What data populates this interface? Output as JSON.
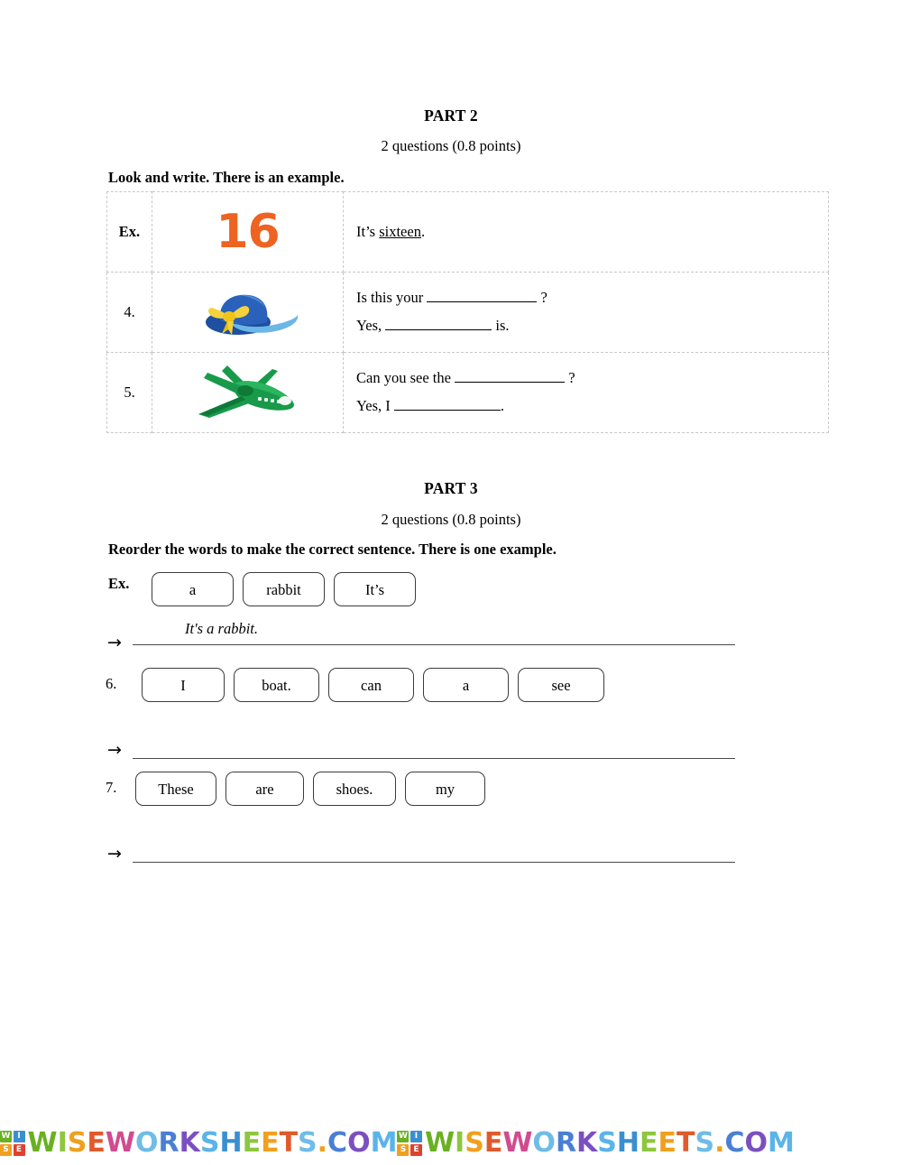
{
  "part2": {
    "title": "PART 2",
    "subtitle": "2 questions (0.8 points)",
    "instruction": "Look and write. There is an example.",
    "rows": [
      {
        "number": "Ex.",
        "picture": "number-16-icon",
        "picture_value": "16",
        "picture_color": "#ee6322",
        "text_pre": "It’s ",
        "answer": "sixteen",
        "text_post": ".",
        "line2": ""
      },
      {
        "number": "4.",
        "picture": "blue-hat-icon",
        "line1_pre": "Is this your ",
        "line1_post": " ?",
        "line2_pre": "Yes, ",
        "line2_post": " is."
      },
      {
        "number": "5.",
        "picture": "green-airplane-icon",
        "line1_pre": "Can you see the ",
        "line1_post": " ?",
        "line2_pre": "Yes, I ",
        "line2_post": "."
      }
    ]
  },
  "part3": {
    "title": "PART 3",
    "subtitle": "2 questions (0.8 points)",
    "instruction": "Reorder the words to make the correct sentence. There is one example.",
    "items": [
      {
        "label": "Ex.",
        "words": [
          "a",
          "rabbit",
          "It’s"
        ],
        "answer": "It's a rabbit.",
        "arrow": "→"
      },
      {
        "label": "6.",
        "words": [
          "I",
          "boat.",
          "can",
          "a",
          "see"
        ],
        "answer": "",
        "arrow": "→"
      },
      {
        "label": "7.",
        "words": [
          "These",
          "are",
          "shoes.",
          "my"
        ],
        "answer": "",
        "arrow": "→"
      }
    ]
  },
  "footer": {
    "logo_letters": [
      "W",
      "I",
      "S",
      "E"
    ],
    "logo_colors": [
      "#6ab023",
      "#3a8fd0",
      "#f0a01e",
      "#e0402e"
    ],
    "watermark_text": "WISEWORKSHEETS.COM",
    "letter_colors": [
      "#6ab023",
      "#8dc63f",
      "#f0a01e",
      "#e05a2b",
      "#d14b8f",
      "#6fbce8",
      "#4a7fd4",
      "#7b4fc0",
      "#5bb4e8",
      "#3a8fd0",
      "#8dc63f",
      "#f0a01e",
      "#e05a2b",
      "#6fbce8",
      "#4a7fd4",
      "#7b4fc0",
      "#5bb4e8",
      "#3a8fd0"
    ],
    "repeat": 2
  }
}
